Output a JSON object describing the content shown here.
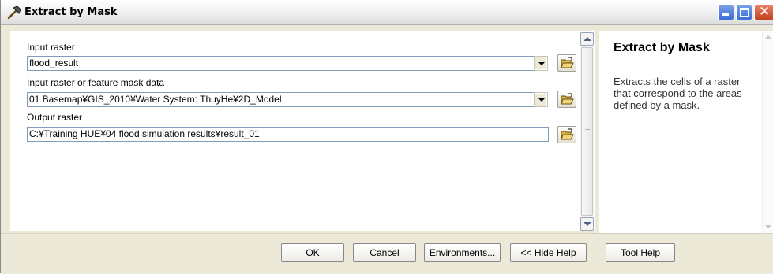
{
  "window": {
    "title": "Extract by Mask"
  },
  "params": {
    "input_raster": {
      "label": "Input raster",
      "value": "flood_result"
    },
    "mask": {
      "label": "Input raster or feature mask data",
      "value": "01 Basemap¥GIS_2010¥Water System: ThuyHe¥2D_Model"
    },
    "output_raster": {
      "label": "Output raster",
      "value": "C:¥Training HUE¥04 flood simulation results¥result_01"
    }
  },
  "help": {
    "title": "Extract by Mask",
    "description": "Extracts the cells of a raster that correspond to the areas defined by a mask."
  },
  "buttons": {
    "ok": "OK",
    "cancel": "Cancel",
    "environments": "Environments...",
    "hide_help": "<< Hide Help",
    "tool_help": "Tool Help"
  },
  "icons": {
    "title": "hammer-icon",
    "browse": "folder-open-icon",
    "dropdown": "chevron-down-icon"
  },
  "colors": {
    "dialog_bg": "#ece9d8",
    "field_border": "#7f9db9",
    "title_buttons": "#3b6fd6",
    "close_button": "#c2421e"
  }
}
